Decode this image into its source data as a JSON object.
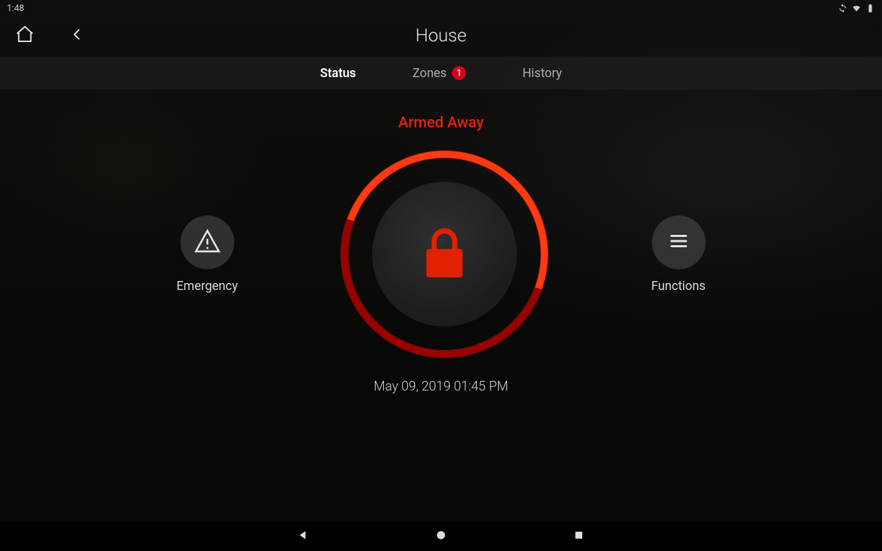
{
  "statusbar": {
    "time": "1:48",
    "icons": [
      "sync-icon",
      "wifi-icon",
      "battery-icon"
    ]
  },
  "appbar": {
    "title": "House"
  },
  "tabs": {
    "status": "Status",
    "zones": "Zones",
    "zones_badge": "1",
    "history": "History"
  },
  "status": {
    "label": "Armed Away",
    "timestamp": "May 09, 2019  01:45 PM"
  },
  "side": {
    "emergency": "Emergency",
    "functions": "Functions"
  },
  "colors": {
    "accent": "#e52207",
    "ring_outer": "#ff3a12",
    "ring_inner": "#9a0000",
    "badge": "#d6001c"
  }
}
